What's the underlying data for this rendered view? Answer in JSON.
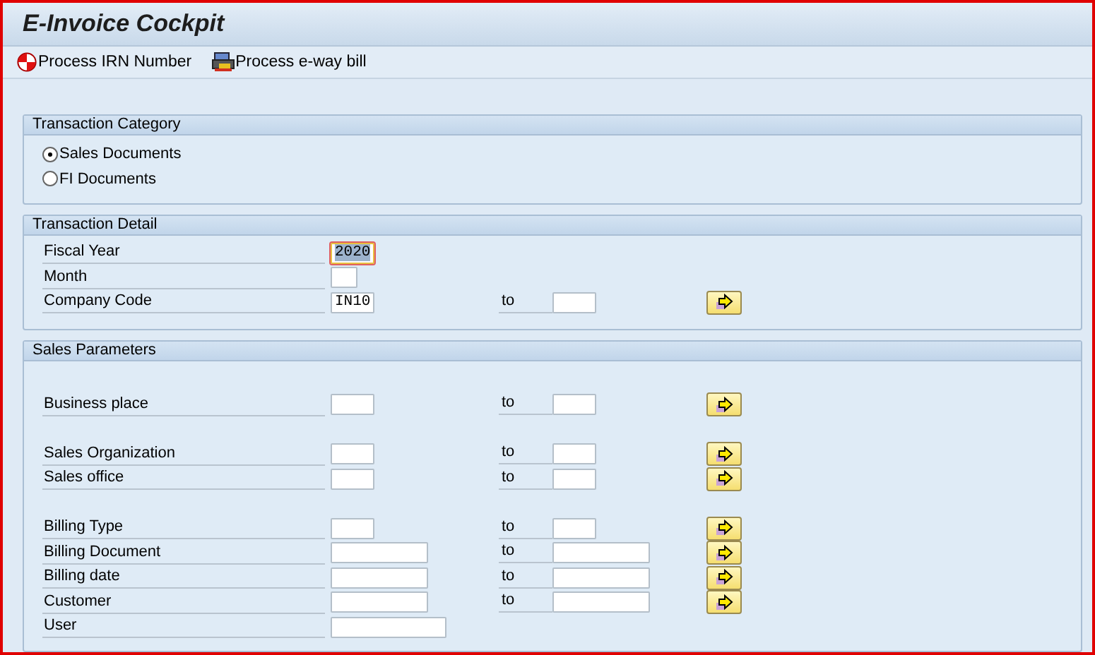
{
  "window": {
    "title": "E-Invoice Cockpit"
  },
  "toolbar": [
    {
      "label": "Process IRN Number",
      "kind": "irn"
    },
    {
      "label": "Process e-way bill",
      "kind": "eway"
    }
  ],
  "groups": [
    {
      "title": "Transaction Category",
      "kind": "radios",
      "options": [
        {
          "label": "Sales Documents",
          "selected": true
        },
        {
          "label": "FI Documents",
          "selected": false
        }
      ]
    },
    {
      "title": "Transaction Detail",
      "kind": "fields",
      "blocks": [
        [
          {
            "label": "Fiscal Year",
            "value": "2020",
            "kind": "short",
            "focused": true
          },
          {
            "label": "Month",
            "kind": "tiny"
          },
          {
            "label": "Company Code",
            "value": "IN10",
            "kind": "short",
            "to": "to",
            "multi": true
          }
        ]
      ]
    },
    {
      "title": "Sales Parameters",
      "kind": "fields",
      "blocks": [
        [
          {
            "label": "Business place",
            "kind": "short",
            "to": "to",
            "multi": true
          }
        ],
        [
          {
            "label": "Sales Organization",
            "kind": "short",
            "to": "to",
            "multi": true
          },
          {
            "label": "Sales office",
            "kind": "short",
            "to": "to",
            "multi": true
          }
        ],
        [
          {
            "label": "Billing Type",
            "kind": "short",
            "to": "to",
            "multi": true
          },
          {
            "label": "Billing Document",
            "kind": "medium",
            "to": "to",
            "multi": true
          },
          {
            "label": "Billing date",
            "kind": "medium",
            "to": "to",
            "multi": true
          },
          {
            "label": "Customer",
            "kind": "medium",
            "to": "to",
            "multi": true
          },
          {
            "label": "User",
            "kind": "long"
          }
        ]
      ]
    }
  ]
}
